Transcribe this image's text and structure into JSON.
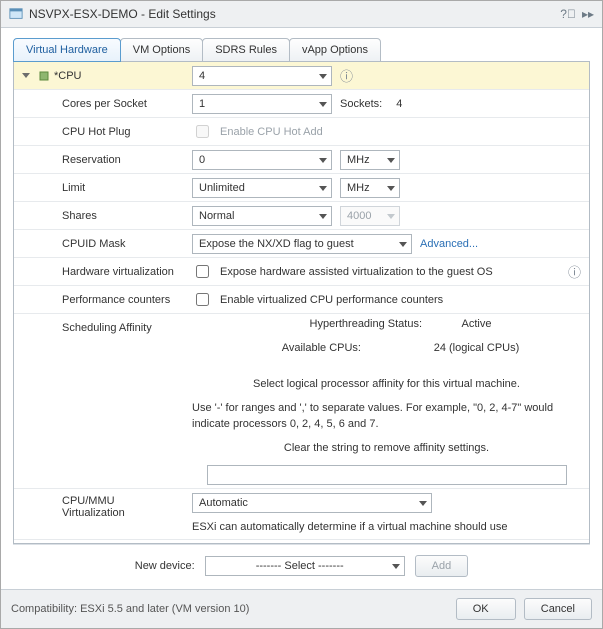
{
  "title": "NSVPX-ESX-DEMO - Edit Settings",
  "tabs": [
    "Virtual Hardware",
    "VM Options",
    "SDRS Rules",
    "vApp Options"
  ],
  "cpu": {
    "label": "*CPU",
    "value": "4",
    "cores_per_socket_label": "Cores per Socket",
    "cores_per_socket": "1",
    "sockets_label": "Sockets:",
    "sockets_value": "4",
    "hotplug_label": "CPU Hot Plug",
    "hotplug_chk": "Enable CPU Hot Add",
    "reservation_label": "Reservation",
    "reservation_value": "0",
    "reservation_unit": "MHz",
    "limit_label": "Limit",
    "limit_value": "Unlimited",
    "limit_unit": "MHz",
    "shares_label": "Shares",
    "shares_value": "Normal",
    "shares_num": "4000",
    "cpuid_label": "CPUID Mask",
    "cpuid_value": "Expose the NX/XD flag to guest",
    "cpuid_advanced": "Advanced...",
    "hwvirt_label": "Hardware virtualization",
    "hwvirt_chk": "Expose hardware assisted virtualization to the guest OS",
    "perf_label": "Performance counters",
    "perf_chk": "Enable virtualized CPU performance counters",
    "sched_label": "Scheduling Affinity",
    "ht_status_label": "Hyperthreading Status:",
    "ht_status_value": "Active",
    "avail_cpus_label": "Available CPUs:",
    "avail_cpus_value": "24 (logical CPUs)",
    "sched_desc1": "Select logical processor affinity for this virtual machine.",
    "sched_desc2": "Use '-' for ranges and ',' to separate values. For example,  \"0, 2, 4-7\" would indicate processors 0, 2, 4, 5, 6 and 7.",
    "sched_desc3": "Clear the string to remove affinity settings.",
    "mmu_label": "CPU/MMU\nVirtualization",
    "mmu_value": "Automatic",
    "mmu_desc": "ESXi can automatically determine if a virtual machine should use"
  },
  "new_device": {
    "label": "New device:",
    "select": "------- Select -------",
    "add": "Add"
  },
  "footer": {
    "compat": "Compatibility: ESXi 5.5 and later (VM version 10)",
    "ok": "OK",
    "cancel": "Cancel"
  }
}
